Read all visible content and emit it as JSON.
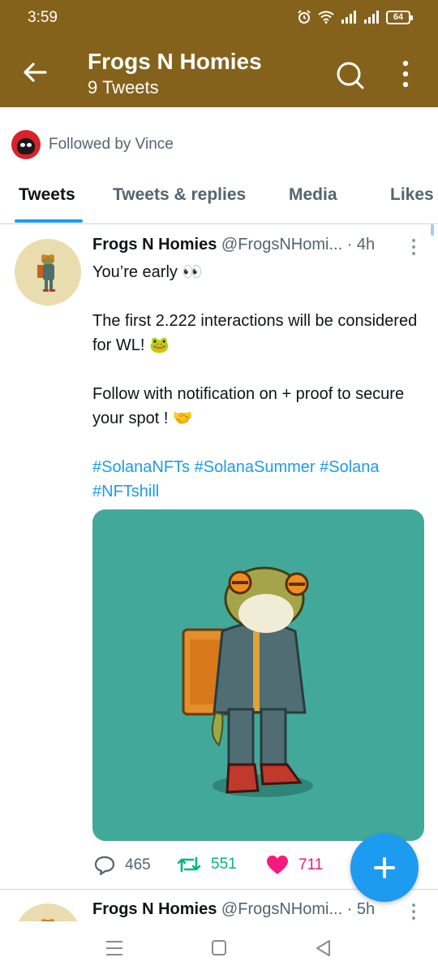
{
  "status_bar": {
    "time": "3:59",
    "battery": "64"
  },
  "header": {
    "title": "Frogs N Homies",
    "subtitle": "9 Tweets"
  },
  "followed_by": {
    "text": "Followed by Vince"
  },
  "tabs": [
    {
      "label": "Tweets",
      "active": true
    },
    {
      "label": "Tweets & replies",
      "active": false
    },
    {
      "label": "Media",
      "active": false
    },
    {
      "label": "Likes",
      "active": false
    }
  ],
  "tweet": {
    "name": "Frogs N Homies",
    "handle_time": "@FrogsNHomi... · 4h",
    "lines": [
      "You’re early 👀",
      "The first 2.222 interactions will be considered for WL! 🐸",
      "Follow with notification on + proof to secure your spot ! 🤝"
    ],
    "hashtags": [
      "#SolanaNFTs",
      "#SolanaSummer",
      "#Solana",
      "#NFTshill"
    ],
    "replies": "465",
    "retweets": "551",
    "likes": "711"
  },
  "tweet2": {
    "name": "Frogs N Homies",
    "handle_time": "@FrogsNHomi... · 5h"
  },
  "colors": {
    "header_bg": "#85621b",
    "accent": "#1d9bf0",
    "media_bg": "#42a99a",
    "retweet": "#00ba7c",
    "like": "#f91880"
  }
}
